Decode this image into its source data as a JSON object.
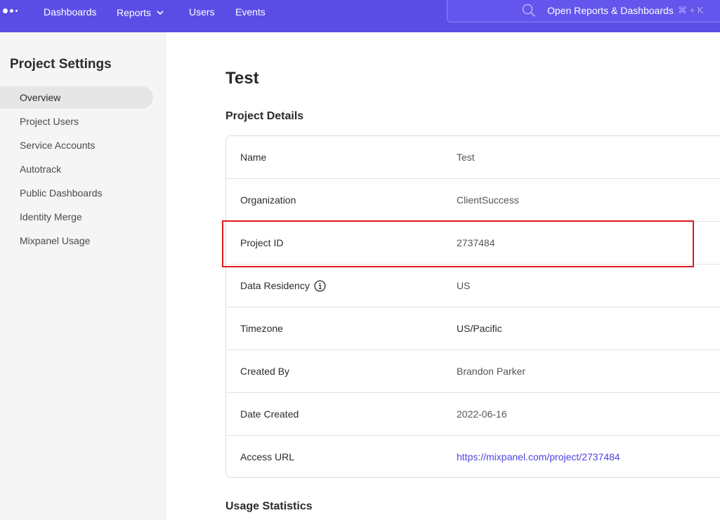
{
  "topbar": {
    "nav": [
      "Dashboards",
      "Reports",
      "Users",
      "Events"
    ],
    "search_label": "Open Reports & Dashboards",
    "search_shortcut": "⌘ + K",
    "accent": "#5a4de6"
  },
  "sidebar": {
    "title": "Project Settings",
    "items": [
      {
        "label": "Overview",
        "active": true
      },
      {
        "label": "Project Users"
      },
      {
        "label": "Service Accounts"
      },
      {
        "label": "Autotrack"
      },
      {
        "label": "Public Dashboards"
      },
      {
        "label": "Identity Merge"
      },
      {
        "label": "Mixpanel Usage"
      }
    ]
  },
  "main": {
    "title": "Test",
    "details_heading": "Project Details",
    "details": [
      {
        "label": "Name",
        "value": "Test"
      },
      {
        "label": "Organization",
        "value": "ClientSuccess"
      },
      {
        "label": "Project ID",
        "value": "2737484"
      },
      {
        "label": "Data Residency",
        "value": "US"
      },
      {
        "label": "Timezone",
        "value": "US/Pacific"
      },
      {
        "label": "Created By",
        "value": "Brandon Parker"
      },
      {
        "label": "Date Created",
        "value": "2022-06-16"
      },
      {
        "label": "Access URL",
        "value": "https://mixpanel.com/project/2737484"
      }
    ],
    "usage_heading": "Usage Statistics",
    "highlight_color": "#e0191e",
    "link_color": "#4f44e0"
  }
}
